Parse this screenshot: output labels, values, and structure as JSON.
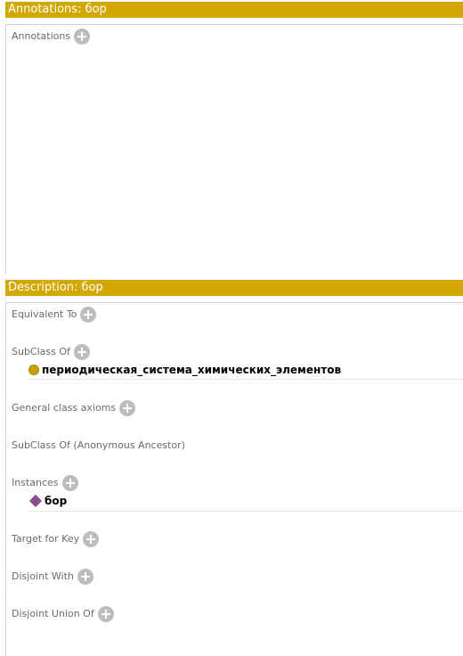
{
  "annotations_section": {
    "header": "Annotations: бор",
    "annotations_label": "Annotations"
  },
  "description_section": {
    "header": "Description: бор",
    "frames": {
      "equivalent_to": "Equivalent To",
      "subclass_of": "SubClass Of",
      "general_class_axioms": "General class axioms",
      "subclass_of_anonymous": "SubClass Of (Anonymous Ancestor)",
      "instances": "Instances",
      "target_for_key": "Target for Key",
      "disjoint_with": "Disjoint With",
      "disjoint_union_of": "Disjoint Union Of"
    },
    "subclass_entries": [
      "периодическая_система_химических_элементов"
    ],
    "instance_entries": [
      "бор"
    ]
  },
  "colors": {
    "header_bar": "#d2a800",
    "class_icon": "#c8a000",
    "individual_icon": "#8a4f8a",
    "add_button": "#bdbdbd"
  },
  "icons": {
    "add": "plus-circle-icon",
    "class": "class-circle-icon",
    "individual": "individual-diamond-icon"
  }
}
